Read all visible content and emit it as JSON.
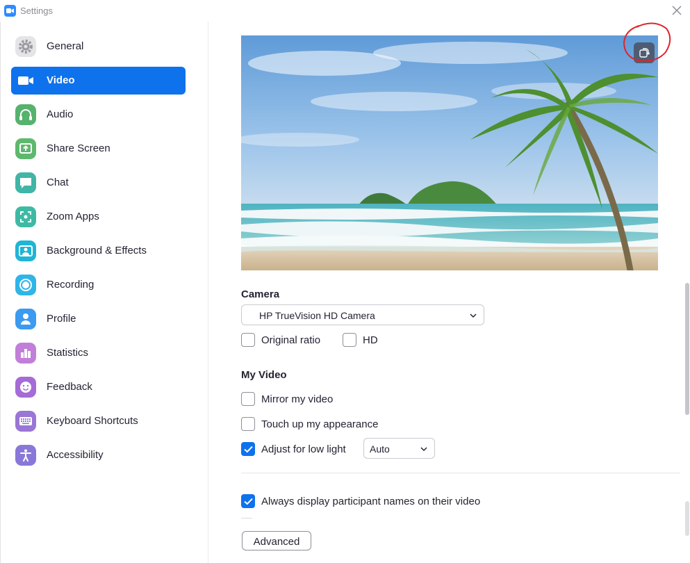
{
  "window": {
    "title": "Settings",
    "logo_icon": "zoom-camera-logo",
    "close_icon": "close-icon"
  },
  "sidebar": {
    "items": [
      {
        "label": "General",
        "icon": "gear-icon",
        "color": "#e5e5e8",
        "active": false
      },
      {
        "label": "Video",
        "icon": "video-camera-icon",
        "color": "#0e72ed",
        "active": true
      },
      {
        "label": "Audio",
        "icon": "headphones-icon",
        "color": "#56b26d",
        "active": false
      },
      {
        "label": "Share Screen",
        "icon": "share-screen-icon",
        "color": "#5eb86d",
        "active": false
      },
      {
        "label": "Chat",
        "icon": "chat-bubble-icon",
        "color": "#41b5a6",
        "active": false
      },
      {
        "label": "Zoom Apps",
        "icon": "zoom-apps-icon",
        "color": "#3ebaa4",
        "active": false
      },
      {
        "label": "Background & Effects",
        "icon": "background-person-icon",
        "color": "#1fb5d6",
        "active": false
      },
      {
        "label": "Recording",
        "icon": "record-icon",
        "color": "#2fb5e8",
        "active": false
      },
      {
        "label": "Profile",
        "icon": "profile-person-icon",
        "color": "#3a9bf0",
        "active": false
      },
      {
        "label": "Statistics",
        "icon": "bar-chart-icon",
        "color": "#c17fd9",
        "active": false
      },
      {
        "label": "Feedback",
        "icon": "smiley-icon",
        "color": "#a56bd6",
        "active": false
      },
      {
        "label": "Keyboard Shortcuts",
        "icon": "keyboard-icon",
        "color": "#9a76d6",
        "active": false
      },
      {
        "label": "Accessibility",
        "icon": "accessibility-icon",
        "color": "#8a78d8",
        "active": false
      }
    ]
  },
  "main": {
    "preview": {
      "rotate_icon": "rotate-camera-icon",
      "annotation_color": "#e0242a"
    },
    "camera": {
      "section_title": "Camera",
      "selected": "HP TrueVision HD Camera",
      "original_ratio": {
        "label": "Original ratio",
        "checked": false
      },
      "hd": {
        "label": "HD",
        "checked": false
      }
    },
    "my_video": {
      "section_title": "My Video",
      "mirror": {
        "label": "Mirror my video",
        "checked": false
      },
      "touch_up": {
        "label": "Touch up my appearance",
        "checked": false
      },
      "low_light": {
        "label": "Adjust for low light",
        "checked": true,
        "mode": "Auto"
      }
    },
    "display_names": {
      "label": "Always display participant names on their video",
      "checked": true
    },
    "advanced_label": "Advanced"
  },
  "colors": {
    "accent": "#0e72ed",
    "text": "#232333"
  }
}
